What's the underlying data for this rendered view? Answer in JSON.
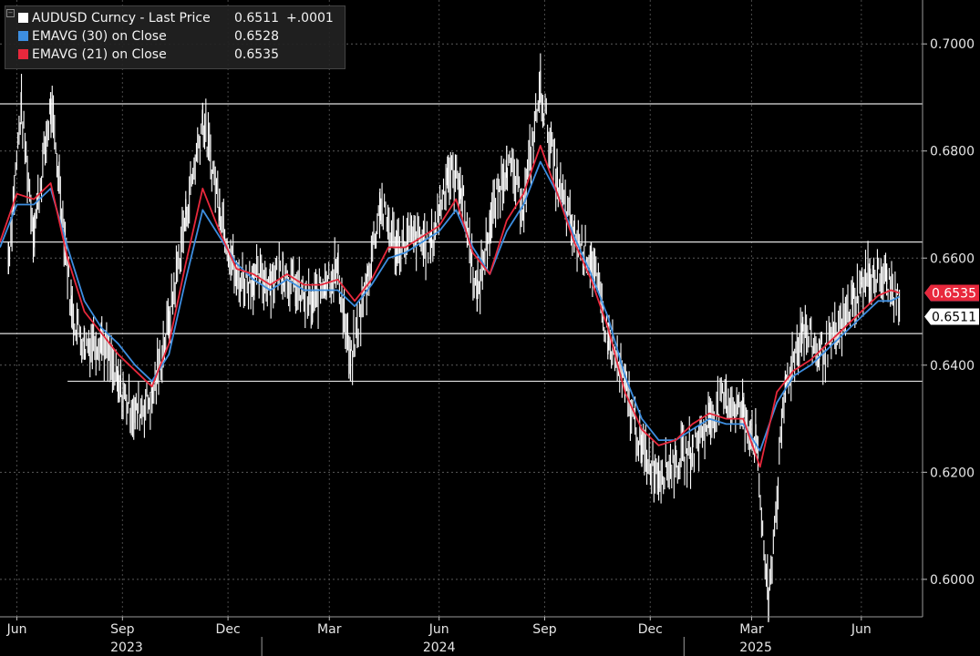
{
  "legend": {
    "last_price": {
      "label": "AUDUSD Curncy - Last Price",
      "value": "0.6511",
      "change": "+.0001",
      "color": "#ffffff"
    },
    "ema30": {
      "label": "EMAVG (30)  on Close",
      "value": "0.6528",
      "color": "#3d8ee0"
    },
    "ema21": {
      "label": "EMAVG (21)  on Close",
      "value": "0.6535",
      "color": "#e8283c"
    }
  },
  "chart_data": {
    "type": "line",
    "ylim": [
      0.593,
      0.7082
    ],
    "y_ticks": [
      "0.7000",
      "0.6800",
      "0.6600",
      "0.6400",
      "0.6200",
      "0.6000"
    ],
    "month_ticks": [
      {
        "label": "Jun",
        "x": 2023.42
      },
      {
        "label": "Sep",
        "x": 2023.67
      },
      {
        "label": "Dec",
        "x": 2023.92
      },
      {
        "label": "Mar",
        "x": 2024.16
      },
      {
        "label": "Jun",
        "x": 2024.42
      },
      {
        "label": "Sep",
        "x": 2024.67
      },
      {
        "label": "Dec",
        "x": 2024.92
      },
      {
        "label": "Mar",
        "x": 2025.16
      },
      {
        "label": "Jun",
        "x": 2025.42
      }
    ],
    "year_labels": [
      {
        "label": "2023",
        "x": 2023.68
      },
      {
        "label": "2024",
        "x": 2024.42
      },
      {
        "label": "2025",
        "x": 2025.17
      }
    ],
    "year_boundaries": [
      2024.0,
      2025.0
    ],
    "horizontal_lines": [
      0.6888,
      0.663,
      0.6459,
      0.637
    ],
    "support_line": {
      "value": 0.637,
      "x_start": 2023.54
    },
    "current_labels": [
      {
        "label": "0.6528",
        "value": 0.6528,
        "color": "#3d8ee0",
        "text_color": "#ffffff"
      },
      {
        "label": "0.6535",
        "value": 0.6535,
        "color": "#e8283c",
        "text_color": "#ffffff"
      },
      {
        "label": "0.6511",
        "value": 0.6511,
        "color": "#ffffff",
        "text_color": "#000000"
      }
    ],
    "series": [
      {
        "name": "AUDUSD Curncy - Last Price",
        "style": "high-low bars",
        "color": "#ffffff",
        "x": [
          2023.4,
          2023.43,
          2023.46,
          2023.5,
          2023.52,
          2023.55,
          2023.58,
          2023.62,
          2023.66,
          2023.7,
          2023.74,
          2023.78,
          2023.82,
          2023.86,
          2023.9,
          2023.94,
          2023.98,
          2024.02,
          2024.05,
          2024.08,
          2024.12,
          2024.15,
          2024.18,
          2024.21,
          2024.25,
          2024.28,
          2024.32,
          2024.36,
          2024.4,
          2024.44,
          2024.47,
          2024.51,
          2024.54,
          2024.58,
          2024.62,
          2024.66,
          2024.7,
          2024.74,
          2024.78,
          2024.82,
          2024.86,
          2024.9,
          2024.94,
          2024.98,
          2025.02,
          2025.06,
          2025.1,
          2025.14,
          2025.17,
          2025.2,
          2025.24,
          2025.28,
          2025.32,
          2025.36,
          2025.4,
          2025.44,
          2025.48,
          2025.51
        ],
        "values": [
          0.66,
          0.688,
          0.665,
          0.688,
          0.675,
          0.65,
          0.644,
          0.645,
          0.636,
          0.631,
          0.634,
          0.648,
          0.668,
          0.686,
          0.67,
          0.656,
          0.656,
          0.656,
          0.658,
          0.654,
          0.651,
          0.656,
          0.658,
          0.64,
          0.656,
          0.67,
          0.662,
          0.664,
          0.662,
          0.676,
          0.674,
          0.653,
          0.666,
          0.678,
          0.67,
          0.692,
          0.674,
          0.664,
          0.66,
          0.645,
          0.636,
          0.624,
          0.62,
          0.622,
          0.624,
          0.63,
          0.634,
          0.631,
          0.626,
          0.595,
          0.636,
          0.647,
          0.642,
          0.645,
          0.652,
          0.657,
          0.656,
          0.6511
        ]
      },
      {
        "name": "EMAVG (30)  on Close",
        "color": "#3d8ee0",
        "x": [
          2023.38,
          2023.42,
          2023.46,
          2023.5,
          2023.54,
          2023.58,
          2023.62,
          2023.66,
          2023.7,
          2023.74,
          2023.78,
          2023.82,
          2023.86,
          2023.9,
          2023.94,
          2023.98,
          2024.02,
          2024.06,
          2024.1,
          2024.14,
          2024.18,
          2024.22,
          2024.26,
          2024.3,
          2024.34,
          2024.38,
          2024.42,
          2024.46,
          2024.5,
          2024.54,
          2024.58,
          2024.62,
          2024.66,
          2024.7,
          2024.74,
          2024.78,
          2024.82,
          2024.86,
          2024.9,
          2024.94,
          2024.98,
          2025.02,
          2025.06,
          2025.1,
          2025.14,
          2025.18,
          2025.22,
          2025.26,
          2025.3,
          2025.34,
          2025.38,
          2025.42,
          2025.46,
          2025.49,
          2025.51
        ],
        "values": [
          0.662,
          0.67,
          0.67,
          0.673,
          0.662,
          0.652,
          0.647,
          0.644,
          0.64,
          0.637,
          0.642,
          0.656,
          0.669,
          0.664,
          0.659,
          0.656,
          0.654,
          0.656,
          0.654,
          0.654,
          0.654,
          0.651,
          0.655,
          0.66,
          0.661,
          0.663,
          0.665,
          0.669,
          0.662,
          0.657,
          0.665,
          0.67,
          0.678,
          0.672,
          0.664,
          0.657,
          0.649,
          0.638,
          0.63,
          0.626,
          0.626,
          0.628,
          0.63,
          0.629,
          0.629,
          0.624,
          0.633,
          0.638,
          0.64,
          0.643,
          0.646,
          0.649,
          0.652,
          0.652,
          0.6528
        ]
      },
      {
        "name": "EMAVG (21)  on Close",
        "color": "#e8283c",
        "x": [
          2023.38,
          2023.42,
          2023.46,
          2023.5,
          2023.54,
          2023.58,
          2023.62,
          2023.66,
          2023.7,
          2023.74,
          2023.78,
          2023.82,
          2023.86,
          2023.9,
          2023.94,
          2023.98,
          2024.02,
          2024.06,
          2024.1,
          2024.14,
          2024.18,
          2024.22,
          2024.26,
          2024.3,
          2024.34,
          2024.38,
          2024.42,
          2024.46,
          2024.5,
          2024.54,
          2024.58,
          2024.62,
          2024.66,
          2024.7,
          2024.74,
          2024.78,
          2024.82,
          2024.86,
          2024.9,
          2024.94,
          2024.98,
          2025.02,
          2025.06,
          2025.1,
          2025.14,
          2025.18,
          2025.22,
          2025.26,
          2025.3,
          2025.34,
          2025.38,
          2025.42,
          2025.46,
          2025.49,
          2025.51
        ],
        "values": [
          0.663,
          0.672,
          0.671,
          0.674,
          0.66,
          0.65,
          0.646,
          0.642,
          0.639,
          0.636,
          0.644,
          0.659,
          0.673,
          0.665,
          0.658,
          0.657,
          0.655,
          0.657,
          0.655,
          0.655,
          0.656,
          0.652,
          0.656,
          0.662,
          0.662,
          0.664,
          0.666,
          0.671,
          0.661,
          0.657,
          0.667,
          0.672,
          0.681,
          0.672,
          0.663,
          0.656,
          0.647,
          0.635,
          0.628,
          0.625,
          0.626,
          0.629,
          0.631,
          0.63,
          0.63,
          0.621,
          0.635,
          0.639,
          0.641,
          0.644,
          0.647,
          0.65,
          0.653,
          0.654,
          0.6535
        ]
      }
    ]
  }
}
